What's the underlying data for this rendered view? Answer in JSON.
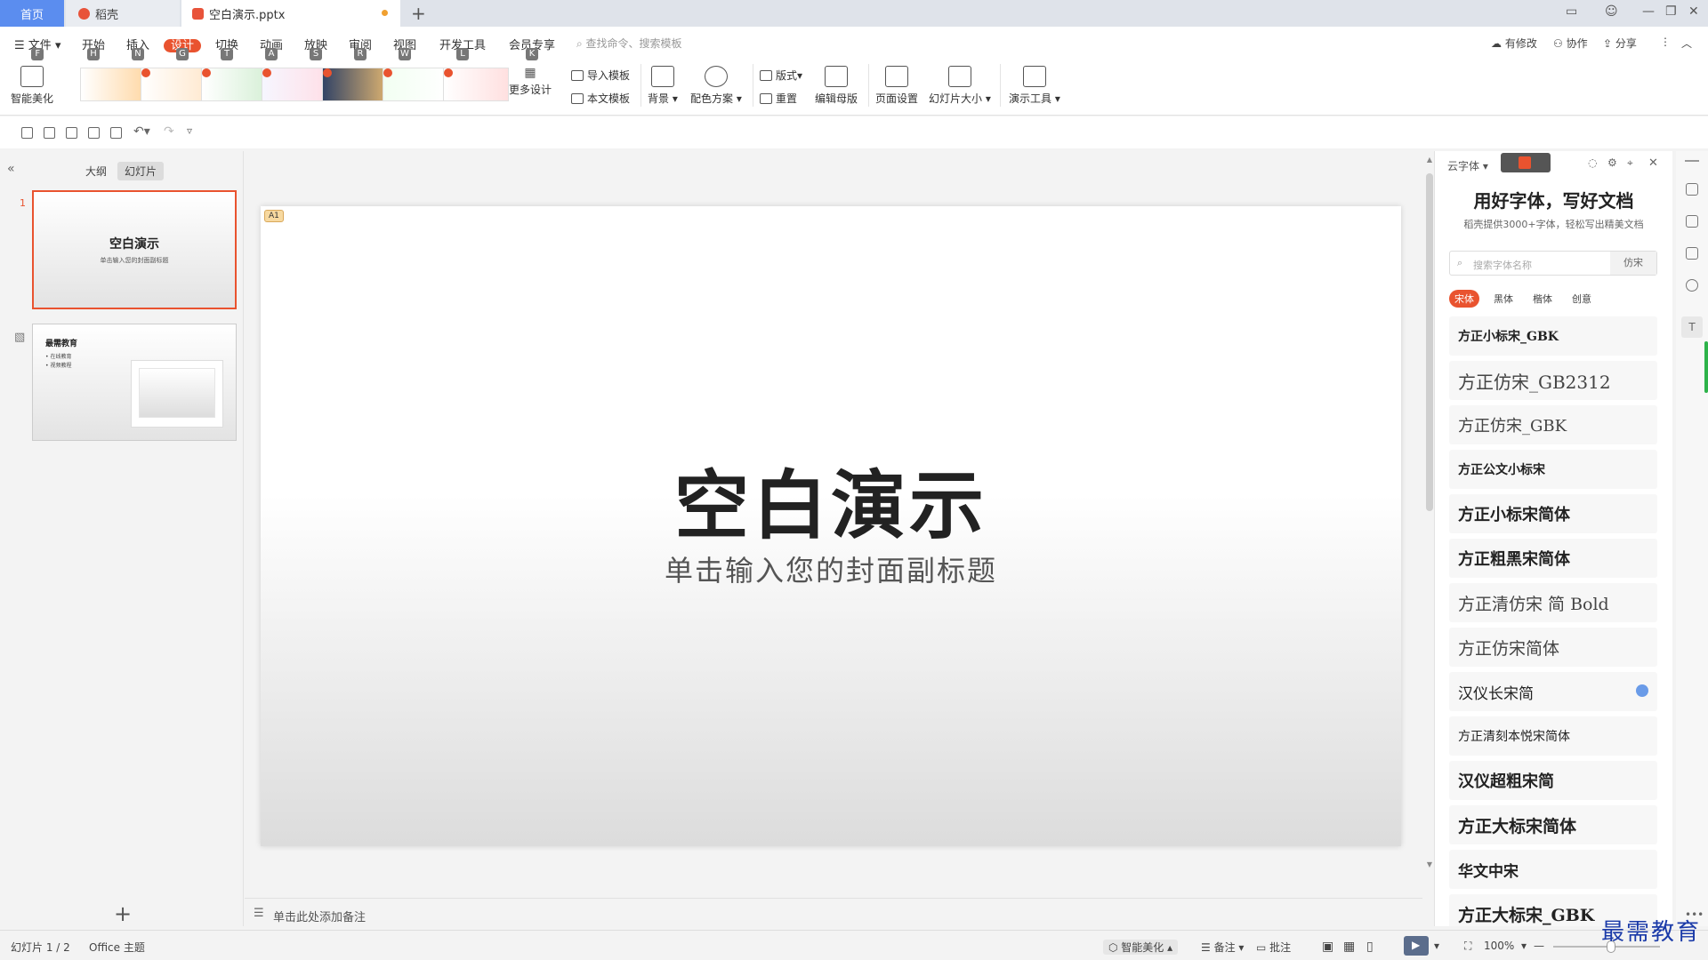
{
  "titlebar": {
    "tabs": [
      {
        "label": "首页"
      },
      {
        "label": "稻壳"
      },
      {
        "label": "空白演示.pptx"
      }
    ]
  },
  "menu": {
    "items": [
      {
        "label": "文件",
        "key": "F"
      },
      {
        "label": "开始",
        "key": "H"
      },
      {
        "label": "插入",
        "key": "N"
      },
      {
        "label": "设计",
        "key": "G"
      },
      {
        "label": "切换",
        "key": "T"
      },
      {
        "label": "动画",
        "key": "A"
      },
      {
        "label": "放映",
        "key": "S"
      },
      {
        "label": "审阅",
        "key": "R"
      },
      {
        "label": "视图",
        "key": "W"
      },
      {
        "label": "开发工具",
        "key": "L"
      },
      {
        "label": "会员专享",
        "key": "K"
      }
    ],
    "search_placeholder": "查找命令、搜索模板",
    "right_actions": [
      {
        "label": "有修改"
      },
      {
        "label": "协作"
      },
      {
        "label": "分享"
      }
    ]
  },
  "ribbon": {
    "smart_beautify": "智能美化",
    "more_design": "更多设计",
    "import_template": "导入模板",
    "this_template": "本文模板",
    "background": "背景",
    "color_scheme": "配色方案",
    "layout": "版式",
    "reset": "重置",
    "edit_master": "编辑母版",
    "page_setup": "页面设置",
    "slide_size": "幻灯片大小",
    "demo_tools": "演示工具"
  },
  "left_panel": {
    "tab_outline": "大纲",
    "tab_slides": "幻灯片",
    "slides": [
      {
        "num": "1",
        "title": "空白演示",
        "subtitle": "单击输入您的封面副标题"
      },
      {
        "num": "",
        "title": "最需教育",
        "bullets": [
          "在线教育",
          "视频教程"
        ]
      }
    ]
  },
  "slide": {
    "badge": "A1",
    "title": "空白演示",
    "subtitle": "单击输入您的封面副标题"
  },
  "notes": {
    "placeholder": "单击此处添加备注"
  },
  "font_panel": {
    "header": "云字体",
    "title": "用好字体，写好文档",
    "subtitle": "稻壳提供3000+字体，轻松写出精美文档",
    "search_placeholder": "搜索字体名称",
    "search_tag": "仿宋",
    "categories": [
      "宋体",
      "黑体",
      "楷体",
      "创意"
    ],
    "fonts": [
      "方正小标宋_GBK",
      "方正仿宋_GB2312",
      "方正仿宋_GBK",
      "方正公文小标宋",
      "方正小标宋简体",
      "方正粗黑宋简体",
      "方正清仿宋 简 Bold",
      "方正仿宋简体",
      "汉仪长宋简",
      "方正清刻本悦宋简体",
      "汉仪超粗宋简",
      "方正大标宋简体",
      "华文中宋",
      "方正大标宋_GBK"
    ]
  },
  "statusbar": {
    "slide_count": "幻灯片 1 / 2",
    "theme": "Office 主题",
    "smart_beautify": "智能美化",
    "notes": "备注",
    "comments": "批注",
    "zoom": "100%"
  },
  "watermark": "最需教育",
  "colors": {
    "accent": "#e9532f",
    "home_tab": "#5b8def"
  }
}
